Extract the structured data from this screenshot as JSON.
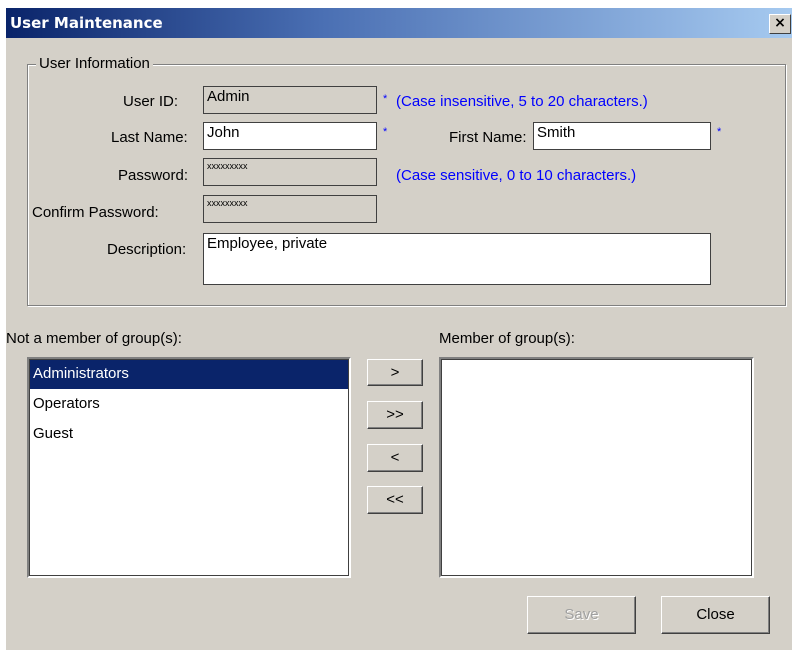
{
  "window": {
    "title": "User Maintenance",
    "close_glyph": "×"
  },
  "user_info": {
    "group_label": "User Information",
    "user_id": {
      "label": "User ID:",
      "value": "Admin",
      "required_mark": "*",
      "hint": "(Case insensitive, 5 to 20 characters.)"
    },
    "last_name": {
      "label": "Last Name:",
      "value": "John",
      "required_mark": "*"
    },
    "first_name": {
      "label": "First Name:",
      "value": "Smith",
      "required_mark": "*"
    },
    "password": {
      "label": "Password:",
      "value": "xxxxxxxxx",
      "hint": "(Case sensitive, 0 to 10 characters.)"
    },
    "confirm_password": {
      "label": "Confirm Password:",
      "value": "xxxxxxxxx"
    },
    "description": {
      "label": "Description:",
      "value": "Employee, private"
    }
  },
  "groups": {
    "not_member_label": "Not a member of group(s):",
    "member_label": "Member of group(s):",
    "not_member_items": [
      {
        "label": "Administrators",
        "selected": true
      },
      {
        "label": "Operators",
        "selected": false
      },
      {
        "label": "Guest",
        "selected": false
      }
    ],
    "member_items": [],
    "transfer_buttons": {
      "add_one": ">",
      "add_all": ">>",
      "remove_one": "<",
      "remove_all": "<<"
    }
  },
  "footer": {
    "save_label": "Save",
    "save_enabled": false,
    "close_label": "Close"
  },
  "colors": {
    "hint": "#0000ff",
    "selection": "#0a246a",
    "dialog_bg": "#d4d0c8"
  }
}
